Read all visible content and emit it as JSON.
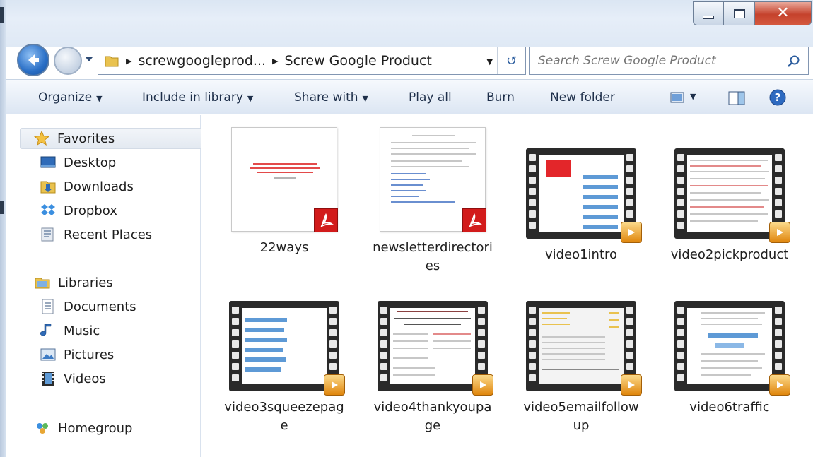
{
  "window": {
    "caption_buttons": {
      "minimize": "minimize",
      "maximize": "maximize",
      "close": "✕"
    }
  },
  "address": {
    "crumbs": [
      "screwgoogleprod...",
      "Screw Google Product"
    ]
  },
  "search": {
    "placeholder": "Search Screw Google Product"
  },
  "commands": {
    "organize": "Organize",
    "include_in_library": "Include in library",
    "share_with": "Share with",
    "play_all": "Play all",
    "burn": "Burn",
    "new_folder": "New folder"
  },
  "nav": {
    "favorites": "Favorites",
    "desktop": "Desktop",
    "downloads": "Downloads",
    "dropbox": "Dropbox",
    "recent_places": "Recent Places",
    "libraries": "Libraries",
    "documents": "Documents",
    "music": "Music",
    "pictures": "Pictures",
    "videos": "Videos",
    "homegroup": "Homegroup"
  },
  "files": [
    {
      "name": "22ways",
      "type": "pdf"
    },
    {
      "name": "newsletterdirectories",
      "type": "pdf"
    },
    {
      "name": "video1intro",
      "type": "video"
    },
    {
      "name": "video2pickproduct",
      "type": "video"
    },
    {
      "name": "video3squeezepage",
      "type": "video"
    },
    {
      "name": "video4thankyoupage",
      "type": "video"
    },
    {
      "name": "video5emailfollowup",
      "type": "video"
    },
    {
      "name": "video6traffic",
      "type": "video"
    }
  ],
  "colors": {
    "accent": "#2a6fc6",
    "pdf_red": "#d21b1b",
    "close_red": "#c5422c"
  }
}
